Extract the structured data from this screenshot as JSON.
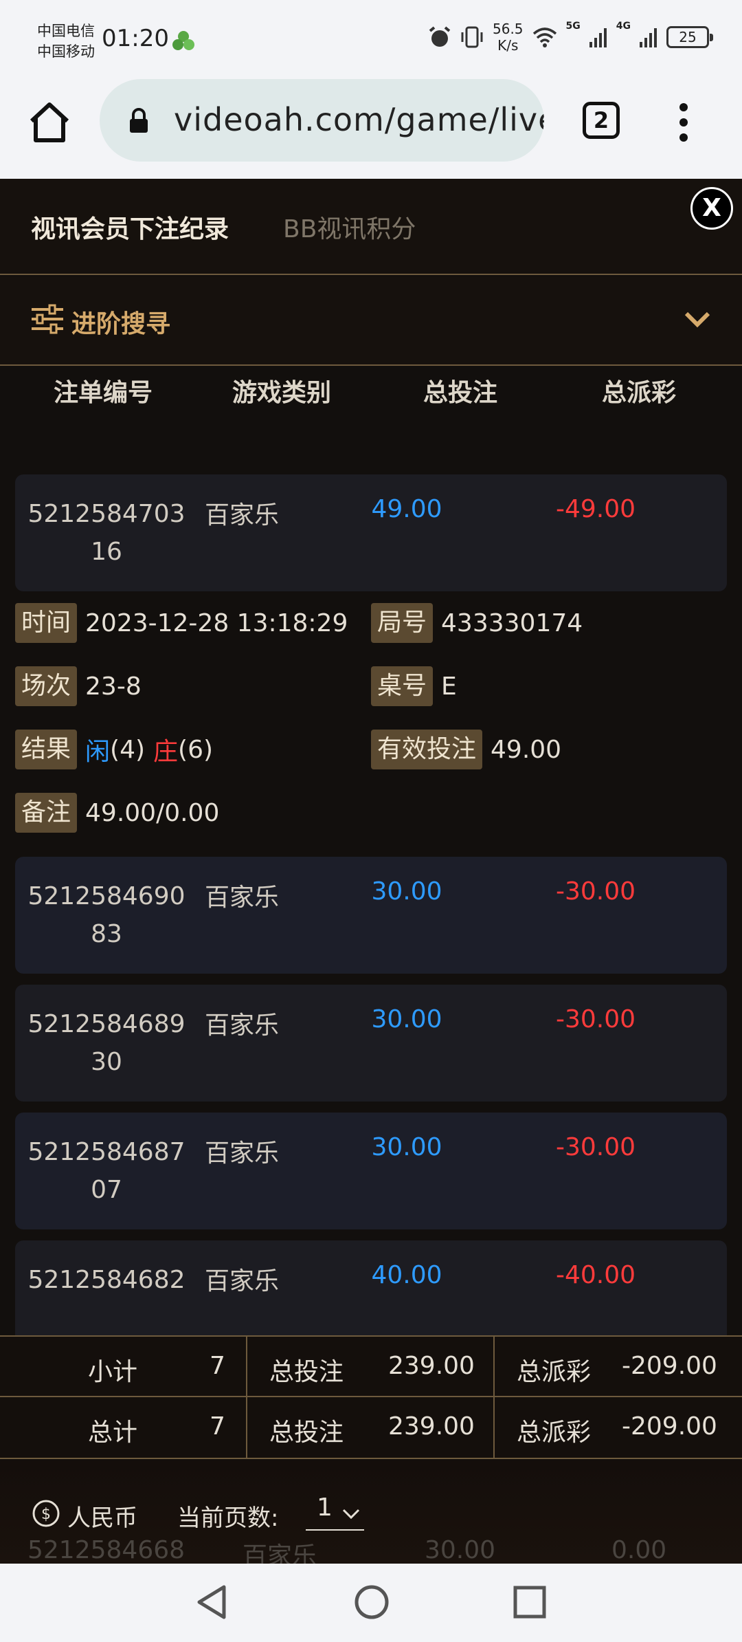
{
  "status_bar": {
    "carrier1": "中国电信",
    "carrier2": "中国移动",
    "time": "01:20",
    "net_speed_value": "56.5",
    "net_speed_unit": "K/s",
    "net1": "5G",
    "net2": "4G",
    "battery": "25"
  },
  "browser": {
    "url": "videoah.com/game/live",
    "tab_count": "2"
  },
  "header": {
    "tab_active": "视讯会员下注纪录",
    "tab_inactive": "BB视讯积分",
    "close_label": "X"
  },
  "advanced_search": {
    "label": "进阶搜寻"
  },
  "columns": [
    "注单编号",
    "游戏类别",
    "总投注",
    "总派彩"
  ],
  "rows": [
    {
      "id_line1": "5212584703",
      "id_line2": "16",
      "game": "百家乐",
      "bet": "49.00",
      "payout": "-49.00"
    },
    {
      "id_line1": "5212584690",
      "id_line2": "83",
      "game": "百家乐",
      "bet": "30.00",
      "payout": "-30.00"
    },
    {
      "id_line1": "5212584689",
      "id_line2": "30",
      "game": "百家乐",
      "bet": "30.00",
      "payout": "-30.00"
    },
    {
      "id_line1": "5212584687",
      "id_line2": "07",
      "game": "百家乐",
      "bet": "30.00",
      "payout": "-30.00"
    },
    {
      "id_line1": "5212584682",
      "id_line2": "",
      "game": "百家乐",
      "bet": "40.00",
      "payout": "-40.00"
    }
  ],
  "details": {
    "time_label": "时间",
    "time_value": "2023-12-28 13:18:29",
    "round_label": "局号",
    "round_value": "433330174",
    "session_label": "场次",
    "session_value": "23-8",
    "table_label": "桌号",
    "table_value": "E",
    "result_label": "结果",
    "result_player": "闲",
    "result_player_pts": "(4)",
    "result_banker": "庄",
    "result_banker_pts": "(6)",
    "valid_bet_label": "有效投注",
    "valid_bet_value": "49.00",
    "remark_label": "备注",
    "remark_value": "49.00/0.00"
  },
  "summary": {
    "subtotal_label": "小计",
    "subtotal_count": "7",
    "total_label": "总计",
    "total_count": "7",
    "bet_label": "总投注",
    "bet_value": "239.00",
    "payout_label": "总派彩",
    "payout_value": "-209.00"
  },
  "footer": {
    "currency": "人民币",
    "page_label": "当前页数:",
    "page_value": "1",
    "ghost_id": "5212584668",
    "ghost_game": "百家乐",
    "ghost_bet": "30.00",
    "ghost_payout": "0.00"
  },
  "colors": {
    "accent_gold": "#d6aa6b",
    "positive_blue": "#2e9bff",
    "negative_red": "#ff3b3b",
    "panel_bg": "#120f0d"
  }
}
